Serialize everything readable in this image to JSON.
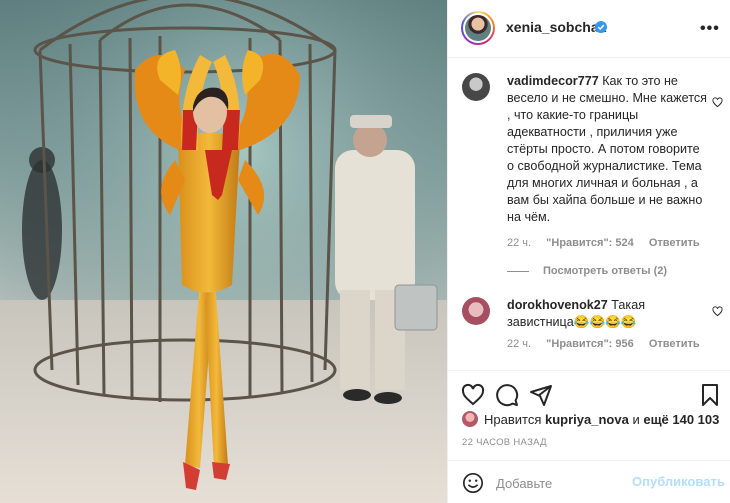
{
  "post": {
    "username": "xenia_sobchak",
    "verified": true
  },
  "comments": [
    {
      "username": "vadimdecor777",
      "text": "Как то это не весело и не смешно. Мне кажется , что какие-то границы адекватности , приличия уже стёрты просто. А потом говорите о свободной журналистике. Тема для многих личная и больная , а вам бы хайпа больше и не важно на чём.",
      "time": "22 ч.",
      "likes": "\"Нравится\": 524",
      "reply": "Ответить",
      "view_replies": "Посмотреть ответы (2)"
    },
    {
      "username": "dorokhovenok27",
      "text": "Такая завистница😂😂😂😂",
      "time": "22 ч.",
      "likes": "\"Нравится\": 956",
      "reply": "Ответить"
    }
  ],
  "likes": {
    "prefix": "Нравится",
    "user": "kupriya_nova",
    "middle": "и",
    "rest": "ещё 140 103"
  },
  "timestamp": "22 ЧАСОВ НАЗАД",
  "add_comment": {
    "placeholder": "Добавьте",
    "post_label": "Опубликовать"
  },
  "icons": {
    "more": "more-options-icon",
    "heart": "heart-icon",
    "comment": "comment-icon",
    "share": "share-icon",
    "save": "bookmark-icon",
    "emoji": "emoji-icon"
  },
  "colors": {
    "verified": "#3897f0",
    "text": "#262626",
    "muted": "#8e8e8e",
    "post_button_disabled": "#b2dffc"
  }
}
